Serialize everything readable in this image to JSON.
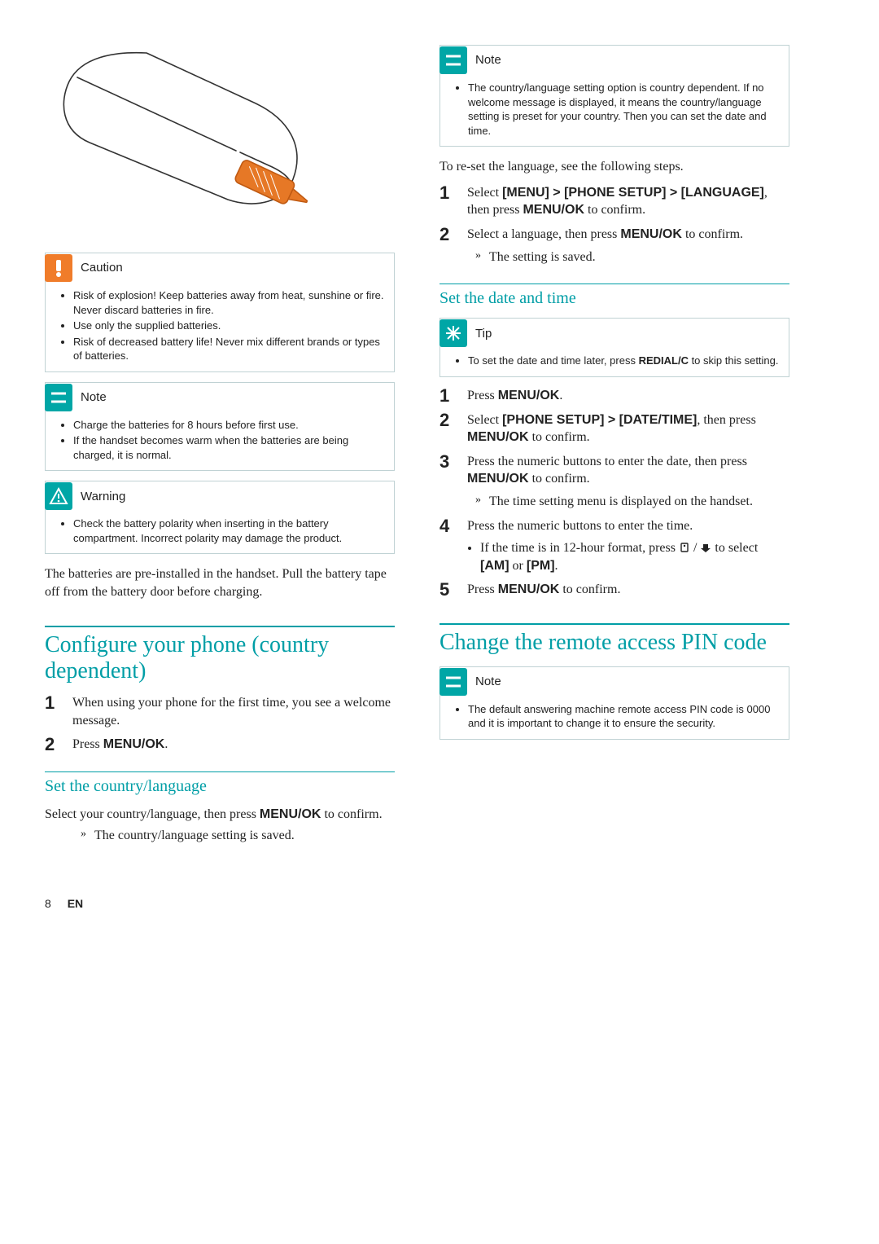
{
  "callouts": {
    "caution": {
      "title": "Caution",
      "items": [
        "Risk of explosion! Keep batteries away from heat, sunshine or fire. Never discard batteries in fire.",
        "Use only the supplied batteries.",
        "Risk of decreased battery life! Never mix different brands or types of batteries."
      ]
    },
    "note1": {
      "title": "Note",
      "items": [
        "Charge the batteries for 8 hours before first use.",
        "If the handset becomes warm when the batteries are being charged, it is normal."
      ]
    },
    "warning": {
      "title": "Warning",
      "items": [
        "Check the battery polarity when inserting in the battery compartment. Incorrect polarity may damage the product."
      ]
    },
    "note2": {
      "title": "Note",
      "items": [
        "The country/language setting option is country dependent. If no welcome message is displayed, it means the country/language setting is preset for your country. Then you can set the date and time."
      ]
    },
    "tip": {
      "title": "Tip",
      "items": [
        "To set the date and time later, press REDIAL/C to skip this setting."
      ]
    },
    "note3": {
      "title": "Note",
      "items": [
        "The default answering machine remote access PIN code is 0000 and it is important to change it to ensure the security."
      ]
    }
  },
  "body_batteries": "The batteries are pre-installed in the handset. Pull the battery tape off from the battery door before charging.",
  "sections": {
    "configure": "Configure your phone (country dependent)",
    "set_lang": "Set the country/language",
    "reset_lang_intro": "To re-set the language, see the following steps.",
    "set_datetime": "Set the date and time",
    "change_pin": "Change the remote access PIN code"
  },
  "configure_steps": {
    "s1": "When using your phone for the first time, you see a welcome message.",
    "s2_prefix": "Press ",
    "s2_key": "MENU/OK",
    "s2_suffix": "."
  },
  "set_lang_body": {
    "intro_a": "Select your country/language, then press ",
    "intro_key": "MENU/OK",
    "intro_b": " to confirm.",
    "result": "The country/language setting is saved."
  },
  "reset_lang_steps": {
    "s1_a": "Select ",
    "s1_path": "[MENU] > [PHONE SETUP] > [LANGUAGE]",
    "s1_b": ", then press ",
    "s1_key": "MENU/OK",
    "s1_c": " to confirm.",
    "s2_a": "Select a language, then press ",
    "s2_key": "MENU/OK",
    "s2_b": " to confirm.",
    "s2_result": "The setting is saved."
  },
  "datetime_steps": {
    "s1_a": "Press ",
    "s1_key": "MENU/OK",
    "s1_b": ".",
    "s2_a": "Select ",
    "s2_path": "[PHONE SETUP] > [DATE/TIME]",
    "s2_b": ", then press ",
    "s2_key": "MENU/OK",
    "s2_c": " to confirm.",
    "s3_a": "Press the numeric buttons to enter the date, then press ",
    "s3_key": "MENU/OK",
    "s3_b": " to confirm.",
    "s3_result": "The time setting menu is displayed on the handset.",
    "s4": "Press the numeric buttons to enter the time.",
    "s4_sub_a": "If the time is in 12-hour format, press ",
    "s4_sub_c": " to select ",
    "s4_sub_am": "[AM]",
    "s4_sub_or": " or ",
    "s4_sub_pm": "[PM]",
    "s4_sub_d": ".",
    "s5_a": "Press ",
    "s5_key": "MENU/OK",
    "s5_b": " to confirm."
  },
  "footer": {
    "page": "8",
    "lang": "EN"
  }
}
